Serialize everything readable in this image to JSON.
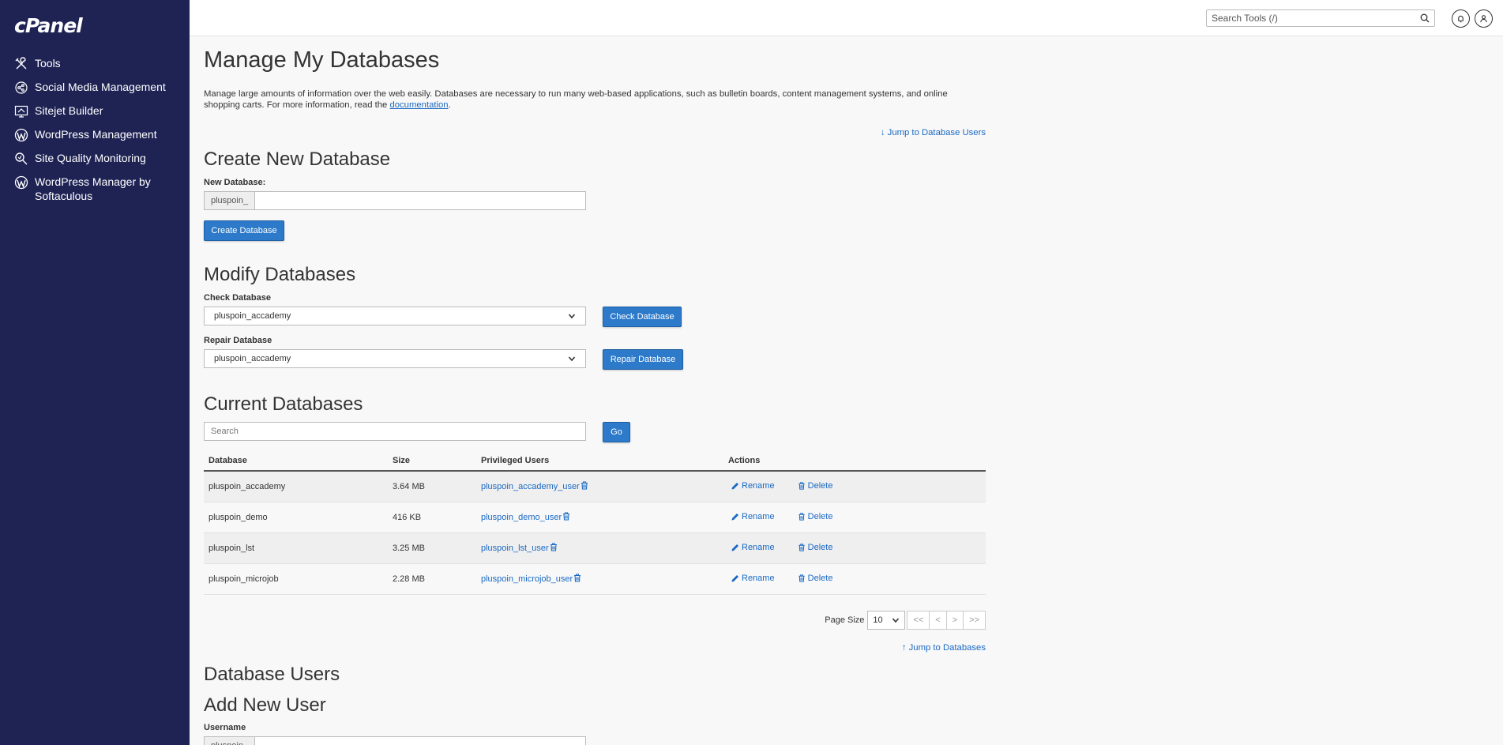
{
  "sidebar": {
    "logo": "cPanel",
    "items": [
      {
        "label": "Tools",
        "icon": "tools-icon"
      },
      {
        "label": "Social Media Management",
        "icon": "social-media-icon"
      },
      {
        "label": "Sitejet Builder",
        "icon": "sitejet-icon"
      },
      {
        "label": "WordPress Management",
        "icon": "wordpress-icon"
      },
      {
        "label": "Site Quality Monitoring",
        "icon": "magnifier-icon"
      },
      {
        "label": "WordPress Manager by Softaculous",
        "icon": "wordpress-icon"
      }
    ]
  },
  "topbar": {
    "search_placeholder": "Search Tools (/)"
  },
  "page": {
    "title": "Manage My Databases",
    "intro_text": "Manage large amounts of information over the web easily. Databases are necessary to run many web-based applications, such as bulletin boards, content management systems, and online shopping carts. For more information, read the ",
    "intro_link": "documentation",
    "intro_end": ".",
    "jump_users": "Jump to Database Users",
    "jump_databases": "Jump to Databases"
  },
  "create": {
    "heading": "Create New Database",
    "label": "New Database:",
    "prefix": "pluspoin_",
    "value": "",
    "button": "Create Database"
  },
  "modify": {
    "heading": "Modify Databases",
    "check_label": "Check Database",
    "check_selected": "pluspoin_accademy",
    "check_button": "Check Database",
    "repair_label": "Repair Database",
    "repair_selected": "pluspoin_accademy",
    "repair_button": "Repair Database"
  },
  "current": {
    "heading": "Current Databases",
    "search_placeholder": "Search",
    "go_button": "Go",
    "columns": [
      "Database",
      "Size",
      "Privileged Users",
      "Actions"
    ],
    "rename_label": "Rename",
    "delete_label": "Delete",
    "rows": [
      {
        "database": "pluspoin_accademy",
        "size": "3.64 MB",
        "user": "pluspoin_accademy_user"
      },
      {
        "database": "pluspoin_demo",
        "size": "416 KB",
        "user": "pluspoin_demo_user"
      },
      {
        "database": "pluspoin_lst",
        "size": "3.25 MB",
        "user": "pluspoin_lst_user"
      },
      {
        "database": "pluspoin_microjob",
        "size": "2.28 MB",
        "user": "pluspoin_microjob_user"
      }
    ],
    "page_size_label": "Page Size",
    "page_size": "10",
    "pager": [
      "<<",
      "<",
      ">",
      ">>"
    ]
  },
  "users": {
    "heading": "Database Users",
    "add_heading": "Add New User",
    "username_label": "Username",
    "prefix": "pluspoin_"
  },
  "colors": {
    "sidebar_bg": "#1f2354",
    "primary_button": "#2c7ac9",
    "link": "#1a69c4"
  }
}
